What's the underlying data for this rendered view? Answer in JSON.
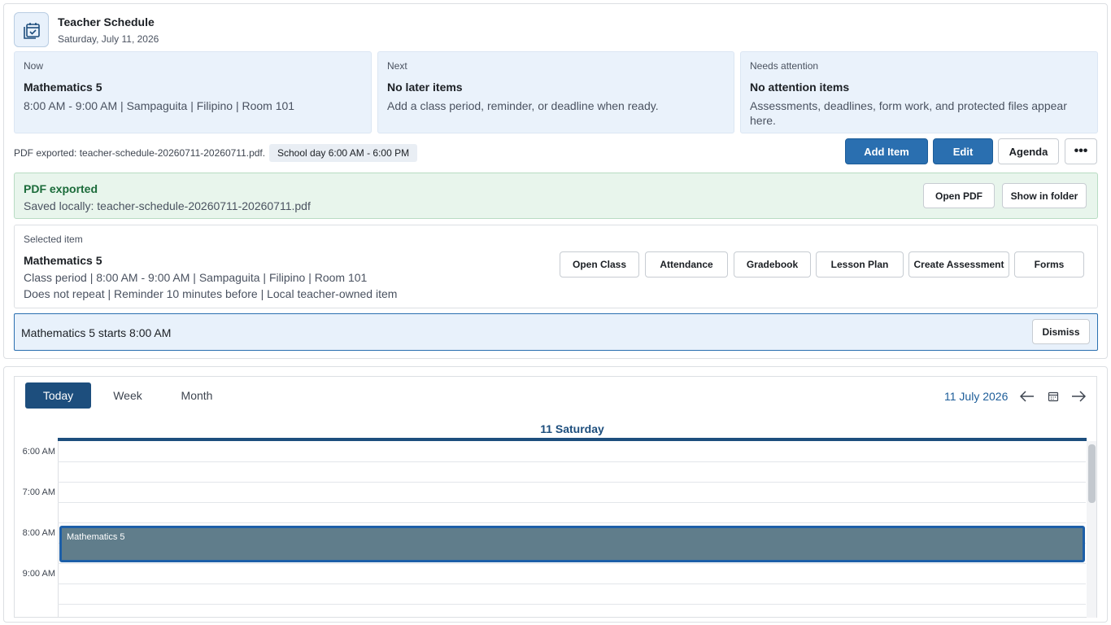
{
  "header": {
    "title": "Teacher Schedule",
    "date": "Saturday, July 11, 2026",
    "icon": "calendar-check-icon"
  },
  "cards": {
    "now": {
      "label": "Now",
      "title": "Mathematics 5",
      "text": "8:00 AM - 9:00 AM | Sampaguita | Filipino | Room 101"
    },
    "next": {
      "label": "Next",
      "title": "No later items",
      "text": "Add a class period, reminder, or deadline when ready."
    },
    "attention": {
      "label": "Needs attention",
      "title": "No attention items",
      "text": "Assessments, deadlines, form work, and protected files appear here."
    }
  },
  "status": {
    "export_text": "PDF exported: teacher-schedule-20260711-20260711.pdf.",
    "school_day": "School day 6:00 AM - 6:00 PM"
  },
  "toolbar": {
    "add_label": "Add Item",
    "edit_label": "Edit",
    "agenda_label": "Agenda",
    "more_label": "•••"
  },
  "export_banner": {
    "title": "PDF exported",
    "text": "Saved locally: teacher-schedule-20260711-20260711.pdf",
    "open_pdf": "Open PDF",
    "show_folder": "Show in folder"
  },
  "selected_item": {
    "label": "Selected item",
    "title": "Mathematics 5",
    "line1": "Class period | 8:00 AM - 9:00 AM | Sampaguita | Filipino | Room 101",
    "line2": "Does not repeat | Reminder 10 minutes before | Local teacher-owned item",
    "actions": {
      "open_class": "Open Class",
      "attendance": "Attendance",
      "gradebook": "Gradebook",
      "lesson_plan": "Lesson Plan",
      "create_assessment": "Create Assessment",
      "forms": "Forms"
    }
  },
  "reminder": {
    "text": "Mathematics 5 starts 8:00 AM",
    "dismiss": "Dismiss"
  },
  "calendar": {
    "tabs": {
      "today": "Today",
      "week": "Week",
      "month": "Month"
    },
    "active_tab": "Today",
    "current_date": "11 July 2026",
    "day_header": "11 Saturday",
    "hours": [
      "6:00 AM",
      "7:00 AM",
      "8:00 AM",
      "9:00 AM"
    ],
    "event": {
      "title": "Mathematics 5",
      "start": "8:00 AM",
      "end": "9:00 AM"
    }
  },
  "colors": {
    "primary": "#2a6fb0",
    "active_tab": "#1d4e7d",
    "card_bg": "#eaf2fb",
    "success_bg": "#e8f5ec",
    "success_text": "#1b6b3a",
    "event_bg": "#607d8b"
  }
}
